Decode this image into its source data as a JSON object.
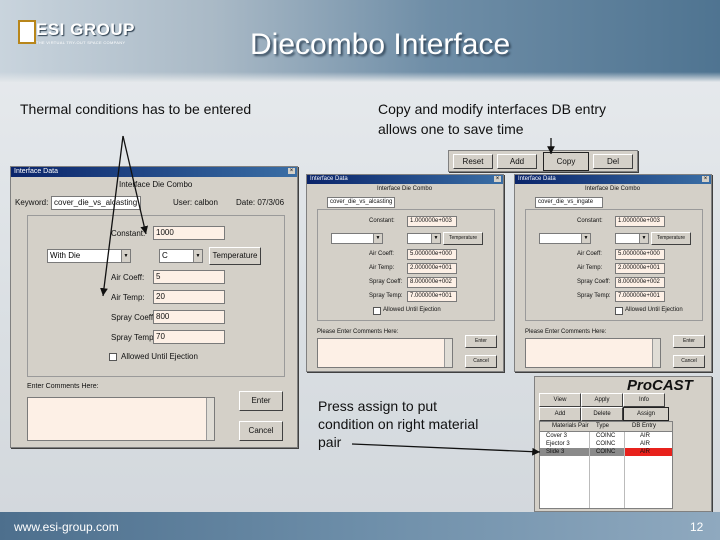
{
  "slide": {
    "title": "Diecombo Interface",
    "logo_text": "ESI GROUP",
    "logo_tagline": "THE VIRTUAL TRY-OUT SPACE COMPANY",
    "caption_left": "Thermal conditions has to be entered",
    "caption_right_line1": "Copy and modify interfaces DB entry",
    "caption_right_line2": "allows one to save time",
    "caption_bottom_line1": "Press assign to put",
    "caption_bottom_line2": "condition on right material",
    "caption_bottom_line3": "pair",
    "footer_url": "www.esi-group.com",
    "page_number": "12"
  },
  "main_dialog": {
    "title": "Interface Data",
    "heading": "Interface Die Combo",
    "keyword_label": "Keyword:",
    "keyword_value": "cover_die_vs_alcasting",
    "user_label": "User: calbon",
    "date_label": "Date: 07/3/06",
    "constant_label": "Constant:",
    "constant_value": "1000",
    "combo_left": "With Die",
    "combo_right": "C",
    "temperature_button": "Temperature",
    "rows": [
      {
        "label": "Air Coeff:",
        "value": "5"
      },
      {
        "label": "Air Temp:",
        "value": "20"
      },
      {
        "label": "Spray Coeff:",
        "value": "800"
      },
      {
        "label": "Spray Temp:",
        "value": "70"
      }
    ],
    "checkbox_label": "Allowed Until Ejection",
    "comment_label": "Enter Comments Here:",
    "enter_button": "Enter",
    "cancel_button": "Cancel"
  },
  "toolbar": {
    "buttons": [
      "Reset",
      "Add",
      "Copy",
      "Del"
    ]
  },
  "copy_dialog_1": {
    "title": "Interface Data",
    "heading": "Interface Die Combo",
    "keyword_value": "cover_die_vs_alcasting",
    "constant_value": "1.000000e+003",
    "row_labels": [
      "Constant:",
      "Air Coeff:",
      "Air Temp:",
      "Spray Coeff:",
      "Spray Temp:"
    ],
    "row_values": [
      "1.000000e+003",
      "5.000000e+000",
      "2.000000e+001",
      "8.000000e+002",
      "7.000000e+001"
    ],
    "temperature_button": "Temperature",
    "checkbox_label": "Allowed Until Ejection",
    "comment_label": "Please Enter Comments Here:",
    "buttons": [
      "Enter",
      "Cancel"
    ]
  },
  "copy_dialog_2": {
    "title": "Interface Data",
    "heading": "Interface Die Combo",
    "keyword_value": "cover_die_vs_ingate",
    "constant_value": "1.000000e+003",
    "row_labels": [
      "Constant:",
      "Air Coeff:",
      "Air Temp:",
      "Spray Coeff:",
      "Spray Temp:"
    ],
    "row_values": [
      "1.000000e+003",
      "5.000000e+000",
      "2.000000e+001",
      "8.000000e+002",
      "7.000000e+001"
    ],
    "temperature_button": "Temperature",
    "checkbox_label": "Allowed Until Ejection",
    "comment_label": "Please Enter Comments Here:",
    "buttons": [
      "Enter",
      "Cancel"
    ]
  },
  "procast_panel": {
    "brand": "ProCAST",
    "row1": [
      "View",
      "Apply",
      "Info"
    ],
    "row2": [
      "Add",
      "Delete",
      "Assign"
    ],
    "columns": [
      "Materials Pair",
      "Type",
      "DB Entry"
    ],
    "rows": [
      [
        "Cover 3",
        "COINC",
        "AIR"
      ],
      [
        "Ejector 3",
        "COINC",
        "AIR"
      ],
      [
        "Slide 3",
        "COINC",
        "AIR"
      ]
    ],
    "highlight_color": "#e8211c"
  },
  "colors": {
    "accent": "#4f7491",
    "field_bg": "#fdf0e6",
    "dialog_bg": "#d4d0c8"
  }
}
